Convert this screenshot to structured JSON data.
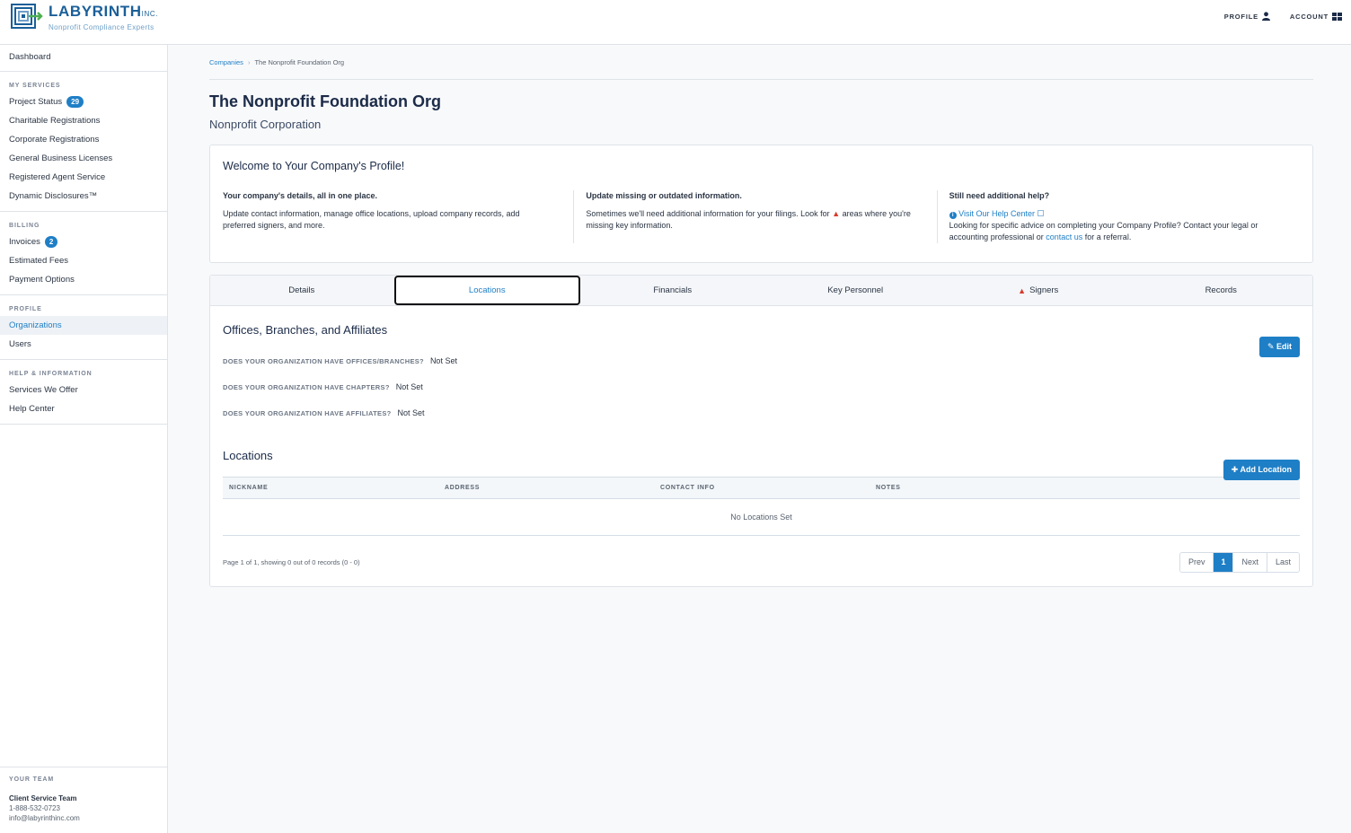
{
  "header": {
    "logo_name": "LABYRINTH",
    "logo_inc": "INC.",
    "logo_tagline": "Nonprofit Compliance Experts",
    "profile_label": "PROFILE",
    "account_label": "ACCOUNT"
  },
  "sidebar": {
    "dashboard": "Dashboard",
    "my_services": {
      "heading": "MY SERVICES",
      "items": [
        {
          "label": "Project Status",
          "badge": "29"
        },
        {
          "label": "Charitable Registrations"
        },
        {
          "label": "Corporate Registrations"
        },
        {
          "label": "General Business Licenses"
        },
        {
          "label": "Registered Agent Service"
        },
        {
          "label": "Dynamic Disclosures™"
        }
      ]
    },
    "billing": {
      "heading": "BILLING",
      "items": [
        {
          "label": "Invoices",
          "badge": "2"
        },
        {
          "label": "Estimated Fees"
        },
        {
          "label": "Payment Options"
        }
      ]
    },
    "profile": {
      "heading": "PROFILE",
      "items": [
        {
          "label": "Organizations"
        },
        {
          "label": "Users"
        }
      ]
    },
    "help": {
      "heading": "HELP & INFORMATION",
      "items": [
        {
          "label": "Services We Offer"
        },
        {
          "label": "Help Center"
        }
      ]
    },
    "team": {
      "heading": "YOUR TEAM",
      "name": "Client Service Team",
      "phone": "1-888-532-0723",
      "email": "info@labyrinthinc.com"
    }
  },
  "breadcrumb": {
    "root": "Companies",
    "current": "The Nonprofit Foundation Org"
  },
  "page": {
    "title": "The Nonprofit Foundation Org",
    "subtitle": "Nonprofit Corporation"
  },
  "welcome": {
    "title": "Welcome to Your Company's Profile!",
    "col1": {
      "heading": "Your company's details, all in one place.",
      "body": "Update contact information, manage office locations, upload company records, add preferred signers, and more."
    },
    "col2": {
      "heading": "Update missing or outdated information.",
      "body_before": "Sometimes we'll need additional information for your filings. Look for",
      "body_after": "areas where you're missing key information."
    },
    "col3": {
      "heading": "Still need additional help?",
      "link": "Visit Our Help Center",
      "body_before": "Looking for specific advice on completing your Company Profile? Contact your legal or accounting professional or",
      "contact_link": "contact us",
      "body_after": "for a referral."
    }
  },
  "tabs": [
    {
      "label": "Details"
    },
    {
      "label": "Locations",
      "active": true
    },
    {
      "label": "Financials"
    },
    {
      "label": "Key Personnel"
    },
    {
      "label": "Signers",
      "warning": true
    },
    {
      "label": "Records"
    }
  ],
  "offices": {
    "title": "Offices, Branches, and Affiliates",
    "edit_label": "Edit",
    "questions": [
      {
        "q": "DOES YOUR ORGANIZATION HAVE OFFICES/BRANCHES?",
        "a": "Not Set"
      },
      {
        "q": "DOES YOUR ORGANIZATION HAVE CHAPTERS?",
        "a": "Not Set"
      },
      {
        "q": "DOES YOUR ORGANIZATION HAVE AFFILIATES?",
        "a": "Not Set"
      }
    ]
  },
  "locations": {
    "title": "Locations",
    "add_label": "Add Location",
    "columns": [
      "NICKNAME",
      "ADDRESS",
      "CONTACT INFO",
      "NOTES"
    ],
    "empty": "No Locations Set",
    "pager_info": "Page 1 of 1, showing 0 out of 0 records (0 - 0)",
    "pager": {
      "prev": "Prev",
      "current": "1",
      "next": "Next",
      "last": "Last"
    }
  },
  "colors": {
    "accent": "#1f7fc6",
    "warning": "#d93a2b"
  }
}
